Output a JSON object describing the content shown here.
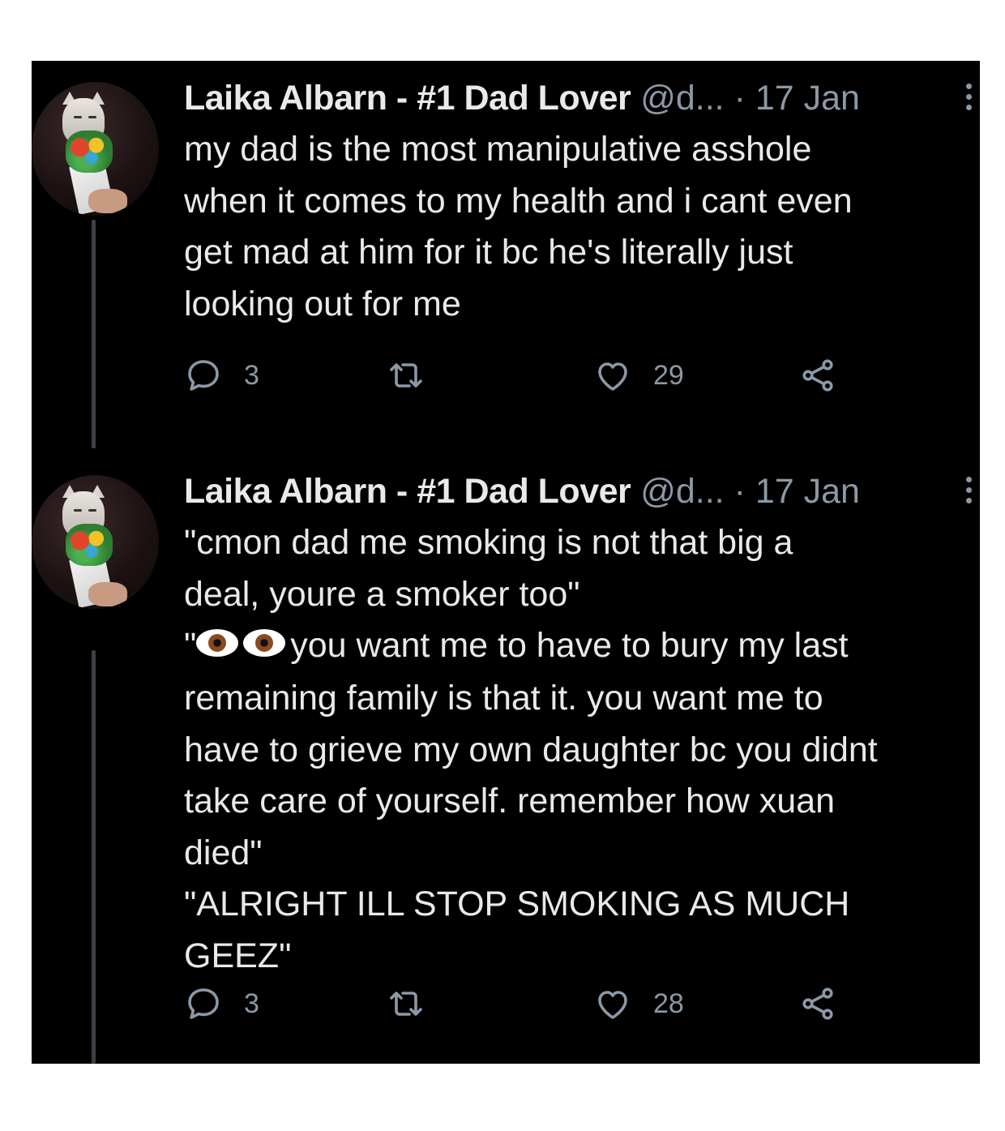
{
  "tweets": [
    {
      "author_name": "Laika Albarn - #1 Dad Lover",
      "handle": "@d...",
      "separator": "·",
      "date": "17 Jan",
      "text": "my dad is the most manipulative asshole\nwhen it comes to my health and i cant even\nget mad at him for it bc he's literally just\nlooking out for me",
      "replies": "3",
      "likes": "29"
    },
    {
      "author_name": "Laika Albarn - #1 Dad Lover",
      "handle": "@d...",
      "separator": "·",
      "date": "17 Jan",
      "text_before_emoji": "\"cmon dad me smoking is not that big a\ndeal, youre a smoker too\"\n\"",
      "emoji": "👁👁",
      "text_after_emoji": "you want me to have to bury my last\nremaining family is that it. you want me to\nhave to grieve my own daughter bc you didnt\ntake care of yourself. remember how xuan\ndied\"\n\"ALRIGHT ILL STOP SMOKING AS MUCH\nGEEZ\"",
      "replies": "3",
      "likes": "28"
    }
  ],
  "icons": {
    "avatar": "cat-with-bouquet-avatar",
    "more": "more-vertical-icon",
    "reply": "reply-bubble-icon",
    "retweet": "retweet-icon",
    "like": "heart-icon",
    "share": "share-icon"
  },
  "colors": {
    "background": "#000000",
    "text": "#e7e9ea",
    "muted": "#8b98a5",
    "thread_line": "#3d4145"
  }
}
